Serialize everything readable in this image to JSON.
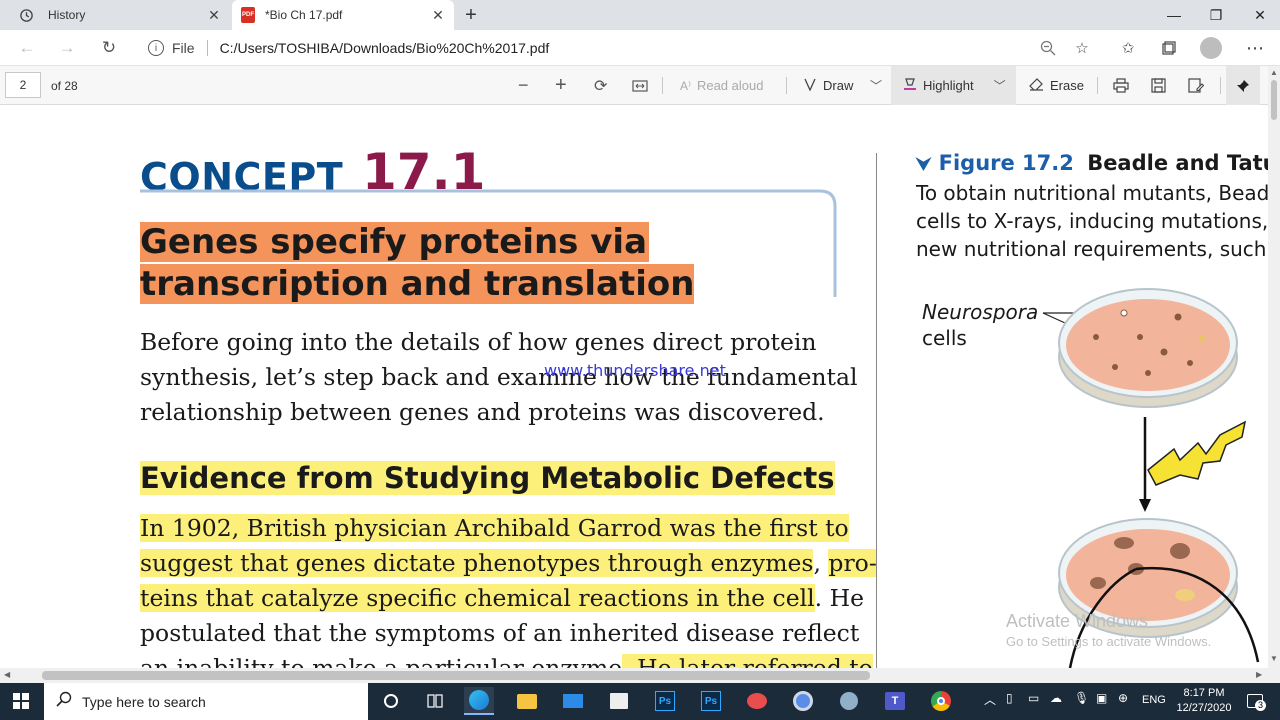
{
  "tabs": [
    {
      "title": "History"
    },
    {
      "title": "*Bio Ch 17.pdf"
    }
  ],
  "address": {
    "info_label": "File",
    "url": "C:/Users/TOSHIBA/Downloads/Bio%20Ch%2017.pdf"
  },
  "pdf_toolbar": {
    "page": "2",
    "of_pages": "of 28",
    "read_aloud": "Read aloud",
    "draw": "Draw",
    "highlight": "Highlight",
    "erase": "Erase"
  },
  "page": {
    "concept_word": "CONCEPT",
    "concept_num": "17.1",
    "heading_line1": "Genes specify proteins via ",
    "heading_line2": "transcription and translation",
    "para1_lines": [
      "Before going into the details of how genes direct protein",
      "synthesis, let’s step back and examine how the fundamental",
      "relationship between genes and proteins was discovered."
    ],
    "watermark": "www.thundershare.net",
    "section_heading": "Evidence from Studying Metabolic Defects",
    "para2_line1": "In 1902, British physician Archibald Garrod was the first to",
    "para2_line2a": "suggest that genes dictate phenotypes through enzymes",
    "para2_line2b": ", ",
    "para2_line2c": "pro-",
    "para2_line3a": "teins that catalyze specific chemical reactions in the cell",
    "para2_line3b": ". He",
    "para2_line4": "postulated that the symptoms of an inherited disease reflect",
    "para2_line5a": "an inability to make a particular enzyme",
    "para2_line5b": ". He later referred to"
  },
  "figure": {
    "label": "Figure 17.2",
    "title": "Beadle and Tatu",
    "cap1": "To obtain nutritional mutants, Bead",
    "cap2": "cells to X-rays, inducing mutations, ",
    "cap3": "new nutritional requirements, such",
    "neuro_italic": "Neurospora",
    "neuro_cells": "cells"
  },
  "activate": {
    "line1": "Activate Windows",
    "line2": "Go to Settings to activate Windows."
  },
  "taskbar": {
    "search": "Type here to search",
    "time": "8:17 PM",
    "date": "12/27/2020",
    "lang": "ENG",
    "notif": "3"
  },
  "colors": {
    "concept_blue": "#0a4d8c",
    "concept_num": "#8b1a4a",
    "heading_hl": "#f4935a",
    "text_hl": "#fdf07a",
    "figure_blue": "#1c5fa8"
  }
}
